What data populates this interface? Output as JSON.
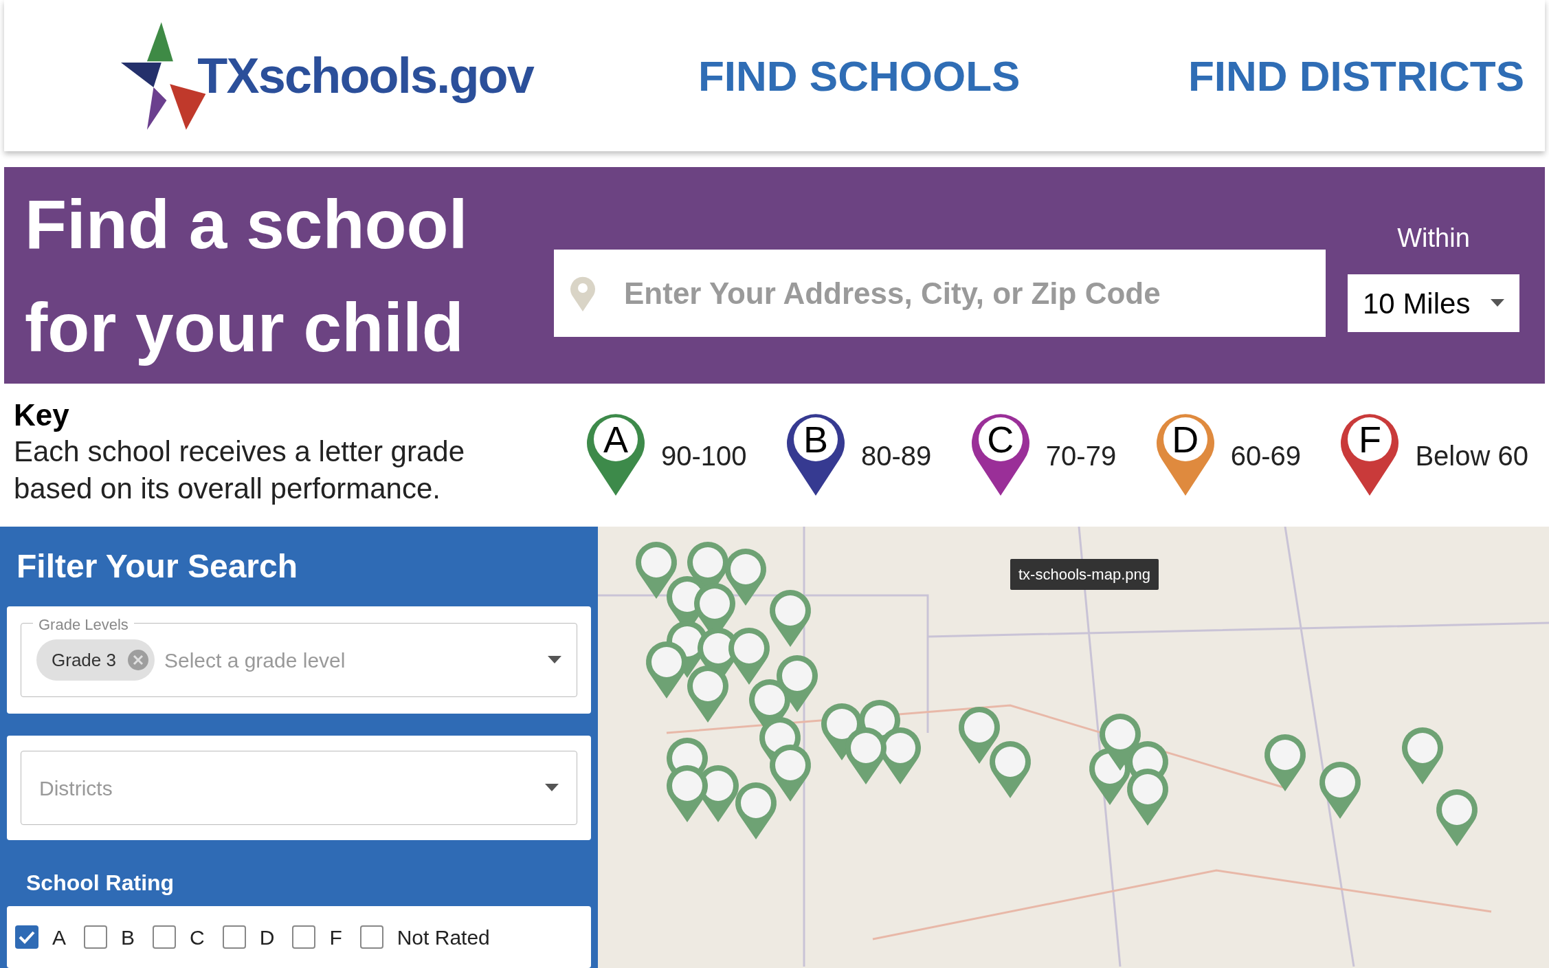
{
  "header": {
    "logo_text": "TXschools.gov",
    "nav": [
      {
        "label": "FIND SCHOOLS"
      },
      {
        "label": "FIND DISTRICTS"
      }
    ]
  },
  "hero": {
    "headline_lines": [
      "Find a school",
      "for your child"
    ],
    "search": {
      "placeholder": "Enter Your Address, City, or Zip Code"
    },
    "within_label": "Within",
    "within_value": "10 Miles"
  },
  "key": {
    "title": "Key",
    "description": "Each school receives a letter grade based on its overall performance.",
    "grades": [
      {
        "letter": "A",
        "range": "90-100",
        "color": "#3d8a4a"
      },
      {
        "letter": "B",
        "range": "80-89",
        "color": "#363a91"
      },
      {
        "letter": "C",
        "range": "70-79",
        "color": "#9a2f98"
      },
      {
        "letter": "D",
        "range": "60-69",
        "color": "#df8a3e"
      },
      {
        "letter": "F",
        "range": "Below 60",
        "color": "#c93a3a"
      }
    ]
  },
  "filter": {
    "title": "Filter Your Search",
    "grade_levels": {
      "label": "Grade Levels",
      "chips": [
        "Grade 3"
      ],
      "placeholder": "Select a grade level"
    },
    "districts": {
      "placeholder": "Districts"
    },
    "rating_title": "School Rating",
    "ratings": [
      {
        "label": "A",
        "checked": true
      },
      {
        "label": "B",
        "checked": false
      },
      {
        "label": "C",
        "checked": false
      },
      {
        "label": "D",
        "checked": false
      },
      {
        "label": "F",
        "checked": false
      },
      {
        "label": "Not Rated",
        "checked": false
      }
    ]
  },
  "map": {
    "tooltip": "tx-schools-map.png"
  }
}
